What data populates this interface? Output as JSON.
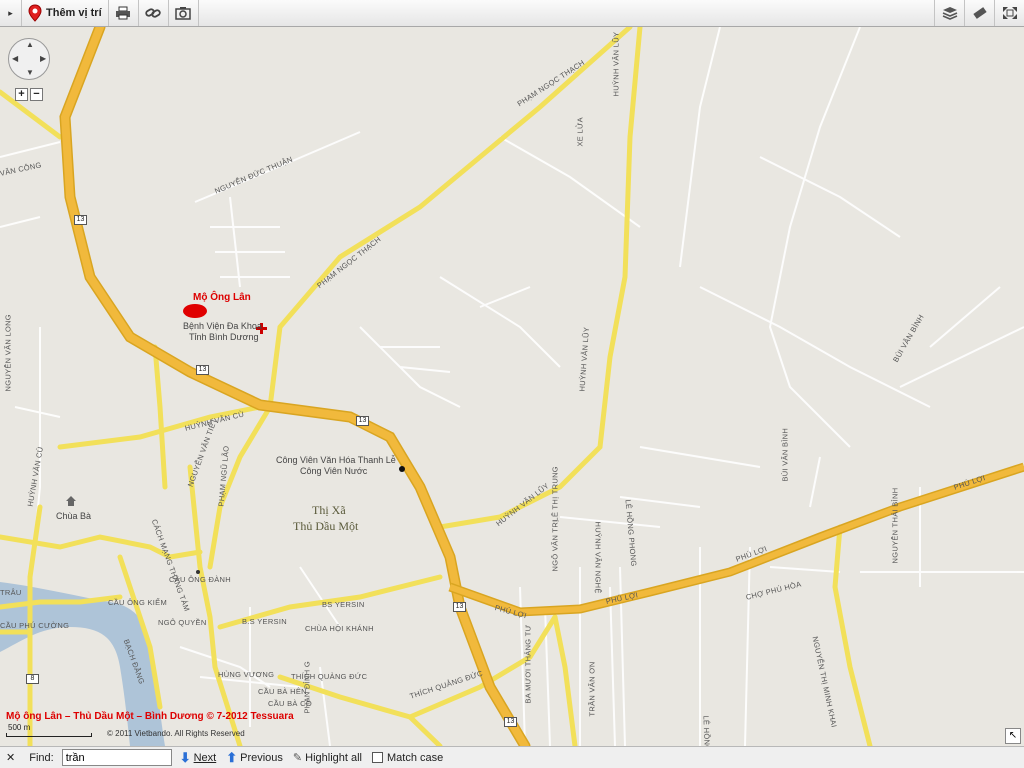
{
  "toolbar": {
    "add_location_label": "Thêm vị trí",
    "buttons": [
      "expand-arrow-icon",
      "map-pin-icon",
      "print-icon",
      "link-icon",
      "camera-icon"
    ],
    "right_buttons": [
      "layers-icon",
      "ruler-icon",
      "fullscreen-icon"
    ]
  },
  "map": {
    "marker_label": "Mộ Ông Lân",
    "hospital_line1": "Bệnh Viện Đa Khoa",
    "hospital_line2": "Tỉnh Bình Dương",
    "park_line1": "Công Viên Văn Hóa Thanh Lễ",
    "park_line2": "Công Viên Nước",
    "town_line1": "Thị Xã",
    "town_line2": "Thủ Dầu Một",
    "chua_ba": "Chùa Bà",
    "highway_number": "13",
    "route_8": "8",
    "roads": {
      "nguyen_duc_thuan": "NGUYỄN ĐỨC THUẬN",
      "pham_ngoc_thach_1": "PHẠM NGỌC THẠCH",
      "pham_ngoc_thach_2": "PHẠM NGỌC THẠCH",
      "huynh_van_luy_1": "HUỲNH VĂN LŨY",
      "huynh_van_luy_2": "HUỲNH VĂN LŨY",
      "huynh_van_luy_3": "HUỲNH VĂN LŨY",
      "xe_lua": "XE LỬA",
      "van_cong": "VĂN CÔNG",
      "nguyen_van_long": "NGUYỄN VĂN LONG",
      "huynh_van_cu_1": "HUỲNH VĂN CÙ",
      "huynh_van_cu_2": "HUỲNH VĂN CÙ",
      "cach_mang_thang_tam": "CÁCH MẠNG THÁNG TÁM",
      "nguyen_van_tiet": "NGUYỄN VĂN TIẾT",
      "pham_ngu_lao": "PHẠM NGŨ LÃO",
      "cau_ong_danh": "CẦU ÔNG ĐÀNH",
      "cau_ong_kiem": "CẦU ÔNG KIỂM",
      "ngo_quyen": "NGÔ QUYỀN",
      "bach_dang": "BẠCH ĐẰNG",
      "b_s_yersin_1": "BS YERSIN",
      "b_s_yersin_2": "B.S YERSIN",
      "chua_hoi_khanh": "CHÙA HỘI KHÁNH",
      "hung_vuong": "HÙNG VƯƠNG",
      "cau_ba_hen": "CẦU BÀ HÊN",
      "thich_quang_duc_1": "THÍCH QUẢNG ĐỨC",
      "thich_quang_duc_2": "THÍCH QUẢNG ĐỨC",
      "phu_loi_1": "PHÚ LỢI",
      "phu_loi_2": "PHÚ LỢI",
      "phu_loi_3": "PHÚ LỢI",
      "phu_loi_4": "PHÚ LỢI",
      "le_thi_trung": "LÊ THỊ TRUNG",
      "huynh_van_nghe": "HUỲNH VĂN NGHỆ",
      "le_hong_phong_1": "LÊ HỒNG PHONG",
      "le_hong_phong_2": "LÊ HỒNG PHONG",
      "ngo_van_tri": "NGÔ VĂN TRỊ",
      "bui_van_binh_1": "BÙI VĂN BÌNH",
      "bui_van_binh_2": "BÙI VĂN BÌNH",
      "cho_phu_hoa": "CHỢ PHÚ HÒA",
      "nguyen_thi_minh_khai": "NGUYỄN THỊ MINH KHAI",
      "nguyen_thai_binh": "NGUYỄN THÁI BÌNH",
      "ba_muoi_thang_tu": "BA MƯƠI THÁNG TƯ",
      "tran_van_on": "TRẦN VĂN ƠN",
      "phu_cuong": "CẦU PHÚ CƯỜNG",
      "trau": "TRÂU",
      "cau_ba_co": "CẦU BÀ CÔ",
      "phan_dinh_giot": "PHAN ĐÌNH G"
    },
    "caption": "Mộ ông Lân – Thủ Dầu Một – Bình Dương © 7-2012 Tessuara",
    "copyright": "© 2011 Vietbando. All Rights Reserved",
    "scale": "500 m"
  },
  "findbar": {
    "find_label": "Find:",
    "query": "trần",
    "next_label": "Next",
    "previous_label": "Previous",
    "highlight_label": "Highlight all",
    "match_case_label": "Match case"
  }
}
